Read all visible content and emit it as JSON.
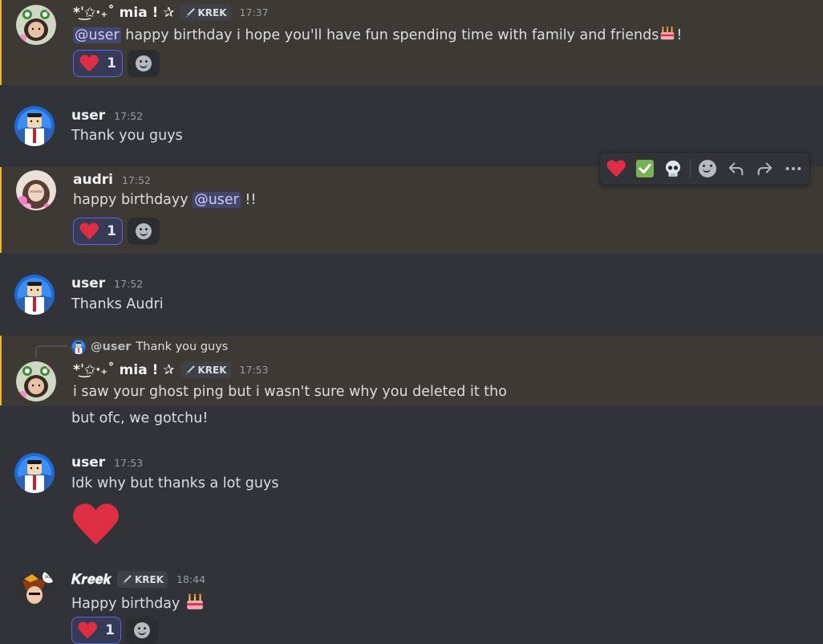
{
  "messages": {
    "mia1": {
      "username": "*ˈ͜✩‧₊˚ mia ! ✰",
      "tag": "KREK",
      "time": "17:37",
      "mention": "@user",
      "text": " happy birthday i hope you'll have fun spending time with family and friends",
      "text_end": "!",
      "reaction_count": "1"
    },
    "user1": {
      "username": "user",
      "time": "17:52",
      "text": "Thank you guys"
    },
    "audri": {
      "username": "audri",
      "time": "17:52",
      "text_before": "happy birthdayy ",
      "mention": "@user",
      "text_after": " !!",
      "reaction_count": "1"
    },
    "user2": {
      "username": "user",
      "time": "17:52",
      "text": "Thanks Audri"
    },
    "mia2": {
      "reply_name": "@user",
      "reply_text": "Thank you guys",
      "username": "*ˈ͜✩‧₊˚ mia ! ✰",
      "tag": "KREK",
      "time": "17:53",
      "text": "i saw your ghost ping but i wasn't sure why you deleted it tho",
      "text2": "but ofc, we gotchu!"
    },
    "user3": {
      "username": "user",
      "time": "17:53",
      "text": "Idk why but thanks a lot guys"
    },
    "kreek": {
      "username": "𝑲𝒓𝒆𝒆𝒌",
      "tag": "KREK",
      "time": "18:44",
      "text": "Happy birthday",
      "reaction_count": "1"
    }
  },
  "toolbar": {
    "icons": [
      "heart-reaction-icon",
      "check-reaction-icon",
      "skull-reaction-icon",
      "add-reaction-icon",
      "reply-icon",
      "forward-icon",
      "more-icon"
    ]
  },
  "colors": {
    "background": "#313338",
    "mention_highlight": "#3d3a35",
    "mention_bar": "#f0b232",
    "heart": "#dd2e44",
    "reaction_border": "#5865f2"
  }
}
